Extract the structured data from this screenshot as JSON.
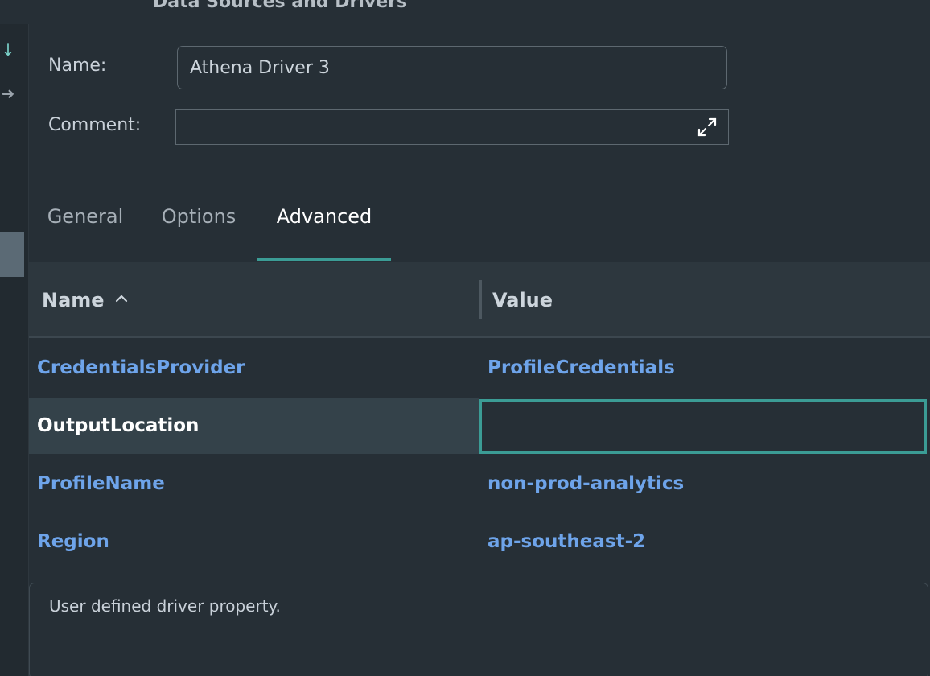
{
  "window": {
    "title": "Data Sources and Drivers"
  },
  "form": {
    "name_label": "Name:",
    "name_value": "Athena Driver 3",
    "comment_label": "Comment:",
    "comment_value": ""
  },
  "tabs": [
    {
      "label": "General",
      "active": false
    },
    {
      "label": "Options",
      "active": false
    },
    {
      "label": "Advanced",
      "active": true
    }
  ],
  "table": {
    "headers": {
      "name": "Name",
      "value": "Value"
    },
    "sort": {
      "column": "name",
      "direction": "ascending"
    },
    "rows": [
      {
        "name": "CredentialsProvider",
        "value": "ProfileCredentials"
      },
      {
        "name": "OutputLocation",
        "value": ""
      },
      {
        "name": "ProfileName",
        "value": "non-prod-analytics"
      },
      {
        "name": "Region",
        "value": "ap-southeast-2"
      }
    ]
  },
  "description": {
    "text": "User defined driver property."
  },
  "colors": {
    "accent": "#3b9c95",
    "link": "#6ea4ea",
    "background": "#262f36"
  }
}
